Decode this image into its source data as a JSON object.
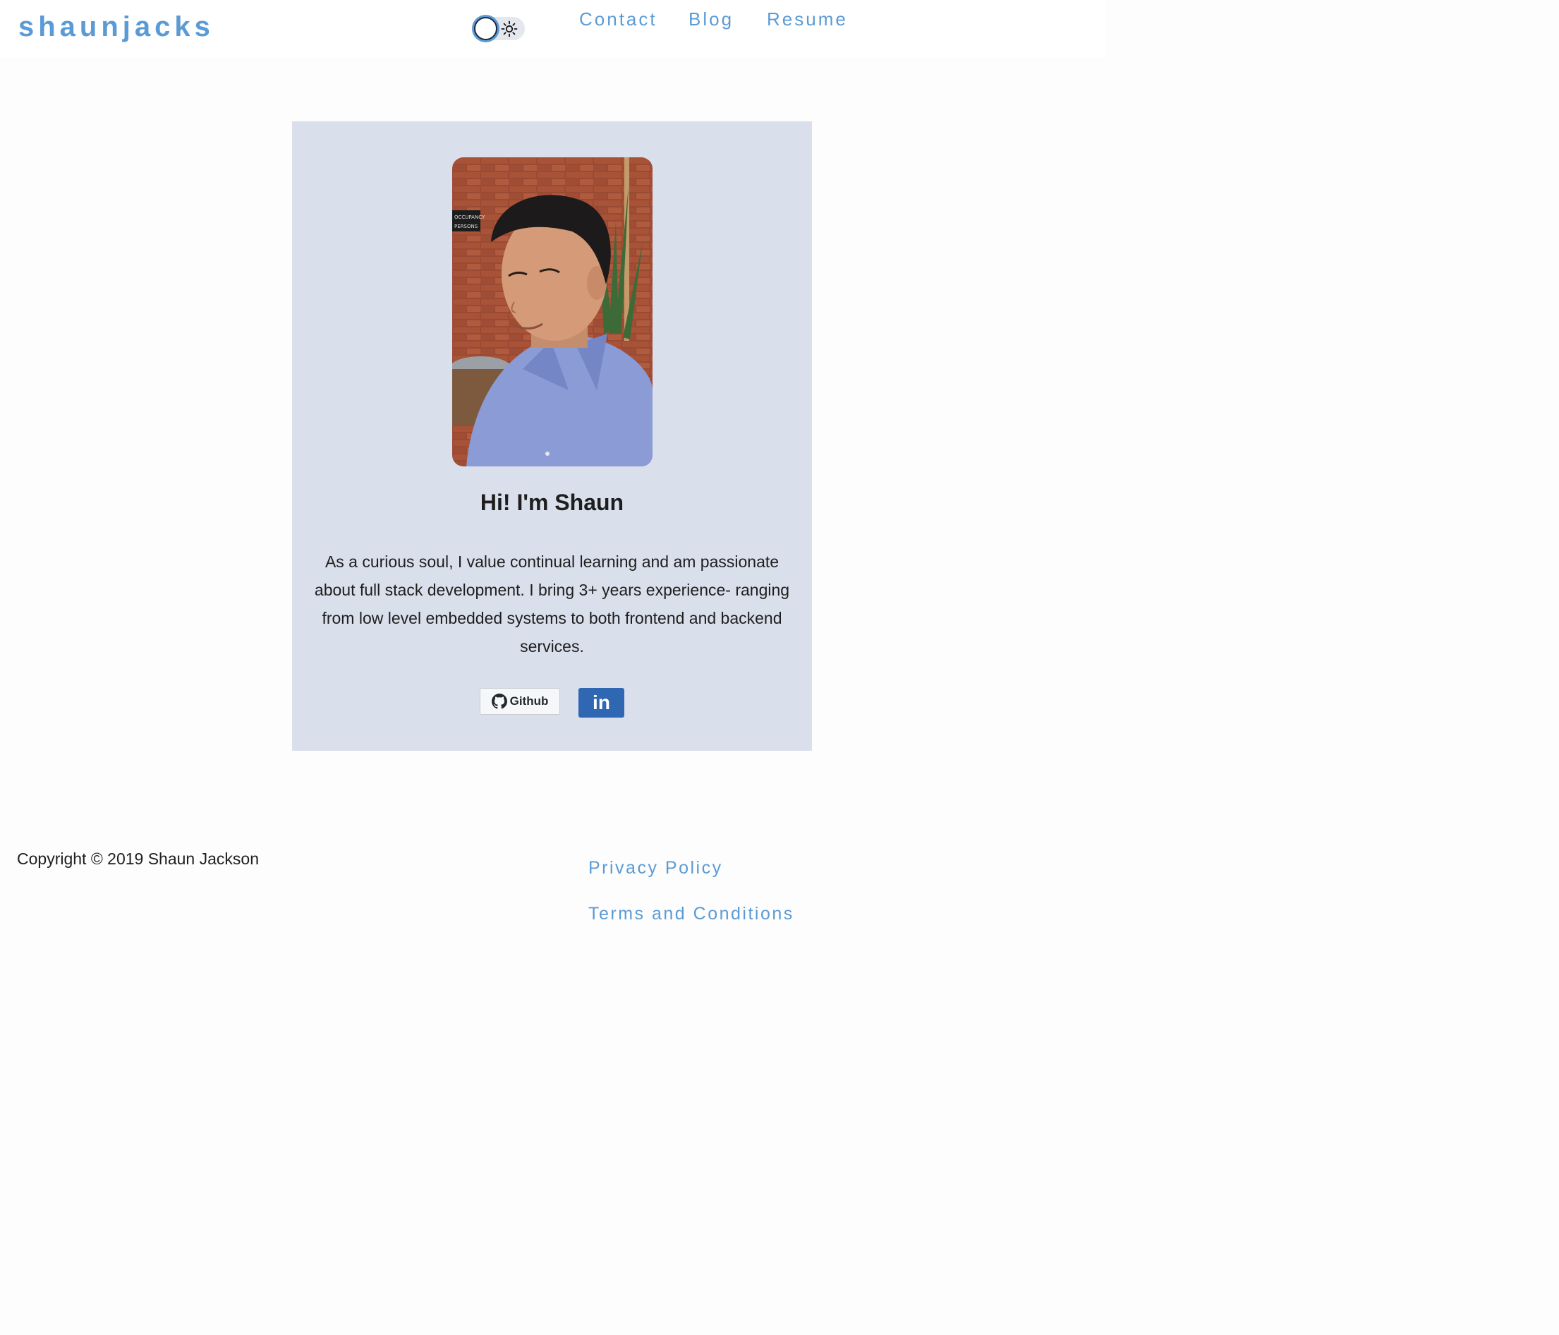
{
  "header": {
    "logo": "shaunjacks",
    "theme_toggle": {
      "state": "light",
      "icon": "sun-icon"
    },
    "nav": [
      {
        "label": "Contact"
      },
      {
        "label": "Blog"
      },
      {
        "label": "Resume"
      }
    ]
  },
  "profile": {
    "photo_alt": "",
    "title": "Hi! I'm Shaun",
    "bio": "As a curious soul, I value continual learning and am passionate about full stack development. I bring 3+ years experience- ranging from low level embedded systems to both frontend and backend services.",
    "buttons": {
      "github_label": "Github",
      "linkedin_label": "in"
    }
  },
  "footer": {
    "copyright": "Copyright © 2019 Shaun Jackson",
    "links": [
      {
        "label": "Privacy Policy"
      },
      {
        "label": "Terms and Conditions"
      }
    ]
  },
  "colors": {
    "accent": "#5b9bd5",
    "card_bg": "#d9dfeb",
    "linkedin": "#2f67b2",
    "text": "#1e1e1e"
  }
}
